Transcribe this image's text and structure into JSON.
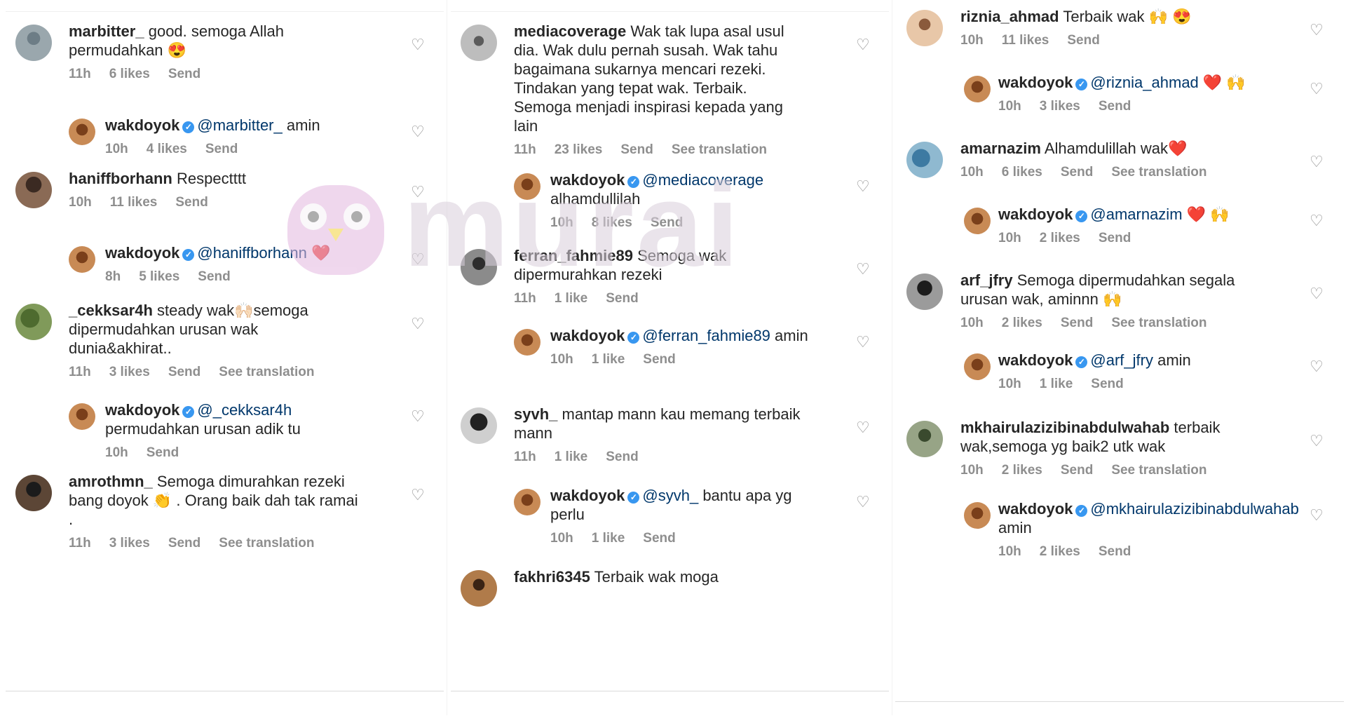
{
  "panels": [
    {
      "comments": [
        {
          "username": "marbitter_",
          "text": "good. semoga Allah permudahkan 😍",
          "time": "11h",
          "likes": "6 likes",
          "actions": [
            "Send"
          ],
          "reply": false
        },
        {
          "username": "wakdoyok",
          "verified": true,
          "mention": "@marbitter_",
          "text": "amin",
          "time": "10h",
          "likes": "4 likes",
          "actions": [
            "Send"
          ],
          "reply": true
        },
        {
          "username": "haniffborhann",
          "text": "Respectttt",
          "time": "10h",
          "likes": "11 likes",
          "actions": [
            "Send"
          ],
          "reply": false
        },
        {
          "username": "wakdoyok",
          "verified": true,
          "mention": "@haniffborhann",
          "text": "❤️",
          "time": "8h",
          "likes": "5 likes",
          "actions": [
            "Send"
          ],
          "reply": true
        },
        {
          "username": "_cekksar4h",
          "text": "steady wak🙌🏻semoga dipermudahkan urusan wak dunia&akhirat..",
          "time": "11h",
          "likes": "3 likes",
          "actions": [
            "Send",
            "See translation"
          ],
          "reply": false
        },
        {
          "username": "wakdoyok",
          "verified": true,
          "mention": "@_cekksar4h",
          "text": "permudahkan urusan adik tu",
          "time": "10h",
          "likes": "",
          "actions": [
            "Send"
          ],
          "reply": true
        },
        {
          "username": "amrothmn_",
          "text": "Semoga dimurahkan rezeki bang doyok 👏 . Orang baik dah tak ramai .",
          "time": "11h",
          "likes": "3 likes",
          "actions": [
            "Send",
            "See translation"
          ],
          "reply": false
        }
      ]
    },
    {
      "comments": [
        {
          "username": "mediacoverage",
          "text": "Wak tak lupa asal usul dia. Wak dulu pernah susah. Wak tahu bagaimana sukarnya mencari rezeki. Tindakan yang tepat wak. Terbaik. Semoga menjadi inspirasi kepada yang lain",
          "time": "11h",
          "likes": "23 likes",
          "actions": [
            "Send",
            "See translation"
          ],
          "reply": false
        },
        {
          "username": "wakdoyok",
          "verified": true,
          "mention": "@mediacoverage",
          "text": "alhamdullilah",
          "time": "10h",
          "likes": "8 likes",
          "actions": [
            "Send"
          ],
          "reply": true
        },
        {
          "username": "ferran_fahmie89",
          "text": "Semoga wak dipermurahkan rezeki",
          "time": "11h",
          "likes": "1 like",
          "actions": [
            "Send"
          ],
          "reply": false
        },
        {
          "username": "wakdoyok",
          "verified": true,
          "mention": "@ferran_fahmie89",
          "text": "amin",
          "time": "10h",
          "likes": "1 like",
          "actions": [
            "Send"
          ],
          "reply": true
        },
        {
          "username": "syvh_",
          "text": "mantap mann kau memang terbaik mann",
          "time": "11h",
          "likes": "1 like",
          "actions": [
            "Send"
          ],
          "reply": false
        },
        {
          "username": "wakdoyok",
          "verified": true,
          "mention": "@syvh_",
          "text": "bantu apa yg perlu",
          "time": "10h",
          "likes": "1 like",
          "actions": [
            "Send"
          ],
          "reply": true
        },
        {
          "username": "fakhri6345",
          "text": "Terbaik wak moga",
          "time": "",
          "likes": "",
          "actions": [],
          "reply": false
        }
      ]
    },
    {
      "comments": [
        {
          "username": "riznia_ahmad",
          "text": "Terbaik wak 🙌 😍",
          "time": "10h",
          "likes": "11 likes",
          "actions": [
            "Send"
          ],
          "reply": false
        },
        {
          "username": "wakdoyok",
          "verified": true,
          "mention": "@riznia_ahmad",
          "text": "❤️ 🙌",
          "time": "10h",
          "likes": "3 likes",
          "actions": [
            "Send"
          ],
          "reply": true
        },
        {
          "username": "amarnazim",
          "text": "Alhamdulillah wak❤️",
          "time": "10h",
          "likes": "6 likes",
          "actions": [
            "Send",
            "See translation"
          ],
          "reply": false
        },
        {
          "username": "wakdoyok",
          "verified": true,
          "mention": "@amarnazim",
          "text": "❤️ 🙌",
          "time": "10h",
          "likes": "2 likes",
          "actions": [
            "Send"
          ],
          "reply": true
        },
        {
          "username": "arf_jfry",
          "text": "Semoga dipermudahkan segala urusan wak, aminnn 🙌",
          "time": "10h",
          "likes": "2 likes",
          "actions": [
            "Send",
            "See translation"
          ],
          "reply": false
        },
        {
          "username": "wakdoyok",
          "verified": true,
          "mention": "@arf_jfry",
          "text": "amin",
          "time": "10h",
          "likes": "1 like",
          "actions": [
            "Send"
          ],
          "reply": true
        },
        {
          "username": "mkhairulazizibinabdulwahab",
          "text": "terbaik wak,semoga yg baik2 utk wak",
          "time": "10h",
          "likes": "2 likes",
          "actions": [
            "Send",
            "See translation"
          ],
          "reply": false
        },
        {
          "username": "wakdoyok",
          "verified": true,
          "mention": "@mkhairulazizibinabdulwahab",
          "text": "amin",
          "time": "10h",
          "likes": "2 likes",
          "actions": [
            "Send"
          ],
          "reply": true
        }
      ]
    }
  ],
  "watermark": {
    "text": "murai"
  },
  "icons": {
    "like": "heart-outline-icon",
    "verified": "verified-badge-icon"
  },
  "colors": {
    "text": "#262626",
    "meta": "#8e8e8e",
    "mention": "#00376b",
    "verified": "#3897f0"
  }
}
